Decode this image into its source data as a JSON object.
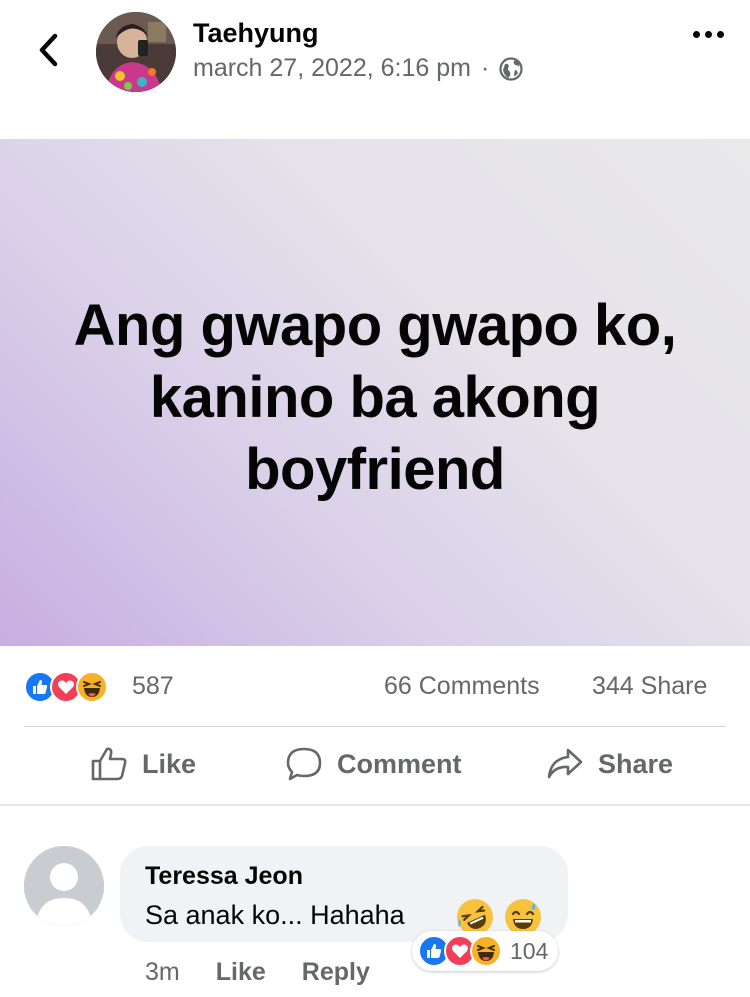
{
  "header": {
    "author": "Taehyung",
    "timestamp": "march 27, 2022, 6:16 pm",
    "separator": "·",
    "privacy_icon": "globe-icon",
    "back_icon": "chevron-left-icon",
    "more_icon": "more-dots-icon"
  },
  "post": {
    "text": "Ang gwapo gwapo ko, kanino ba akong boyfriend"
  },
  "stats": {
    "reaction_count": "587",
    "comments": "66 Comments",
    "shares": "344 Share",
    "reaction_icons": [
      "like-reaction-icon",
      "love-reaction-icon",
      "haha-reaction-icon"
    ]
  },
  "actions": {
    "like_label": "Like",
    "comment_label": "Comment",
    "share_label": "Share"
  },
  "comment": {
    "author": "Teressa Jeon",
    "text": "Sa anak ko... Hahaha",
    "emojis": [
      "rolling-laughing-emoji",
      "sweat-smile-emoji"
    ],
    "reaction_count": "104",
    "time": "3m",
    "like_label": "Like",
    "reply_label": "Reply"
  },
  "colors": {
    "like_blue": "#1877f2",
    "love_red": "#f33e58",
    "haha_yellow": "#f7b125",
    "secondary_text": "#65676b"
  }
}
